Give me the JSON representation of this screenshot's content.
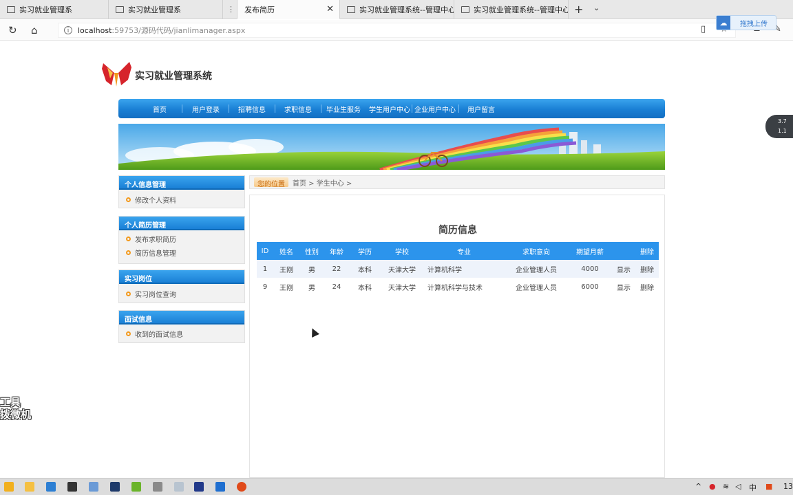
{
  "browser": {
    "tabs": [
      {
        "label": "实习就业管理系",
        "active": false
      },
      {
        "label": "实习就业管理系",
        "active": false
      },
      {
        "label": "发布简历",
        "active": true
      },
      {
        "label": "实习就业管理系统--管理中心",
        "active": false
      },
      {
        "label": "实习就业管理系统--管理中心",
        "active": false
      }
    ],
    "url_host": "localhost",
    "url_path": ":59753/源码代码/jianlimanager.aspx",
    "share_button": "拖拽上传"
  },
  "site": {
    "title": "实习就业管理系统",
    "nav": [
      "首页",
      "用户登录",
      "招聘信息",
      "求职信息",
      "毕业生服务",
      "学生用户中心",
      "企业用户中心",
      "用户留言"
    ]
  },
  "sidebar": [
    {
      "title": "个人信息管理",
      "items": [
        "修改个人资料"
      ]
    },
    {
      "title": "个人简历管理",
      "items": [
        "发布求职简历",
        "简历信息管理"
      ]
    },
    {
      "title": "实习岗位",
      "items": [
        "实习岗位查询"
      ]
    },
    {
      "title": "面试信息",
      "items": [
        "收到的面试信息"
      ]
    }
  ],
  "breadcrumb": {
    "tag": "您的位置",
    "path": "首页 > 学生中心 >"
  },
  "main": {
    "title": "简历信息",
    "columns": [
      "ID",
      "姓名",
      "性别",
      "年龄",
      "学历",
      "学校",
      "专业",
      "求职意向",
      "期望月薪",
      "",
      "删除"
    ],
    "rows": [
      [
        "1",
        "王刚",
        "男",
        "22",
        "本科",
        "天津大学",
        "计算机科学",
        "企业管理人员",
        "4000",
        "显示",
        "删除"
      ],
      [
        "9",
        "王刚",
        "男",
        "24",
        "本科",
        "天津大学",
        "计算机科学与技术",
        "企业管理人员",
        "6000",
        "显示",
        "删除"
      ]
    ]
  },
  "widgets": {
    "speed_up": "3.7",
    "speed_down": "1.1",
    "watermark_line1": "工具",
    "watermark_line2": "拨微机",
    "clock": "13"
  },
  "colors": {
    "nav_blue": "#1a7fd4",
    "header_blue": "#2c94ec",
    "bullet_orange": "#f39a1e"
  }
}
